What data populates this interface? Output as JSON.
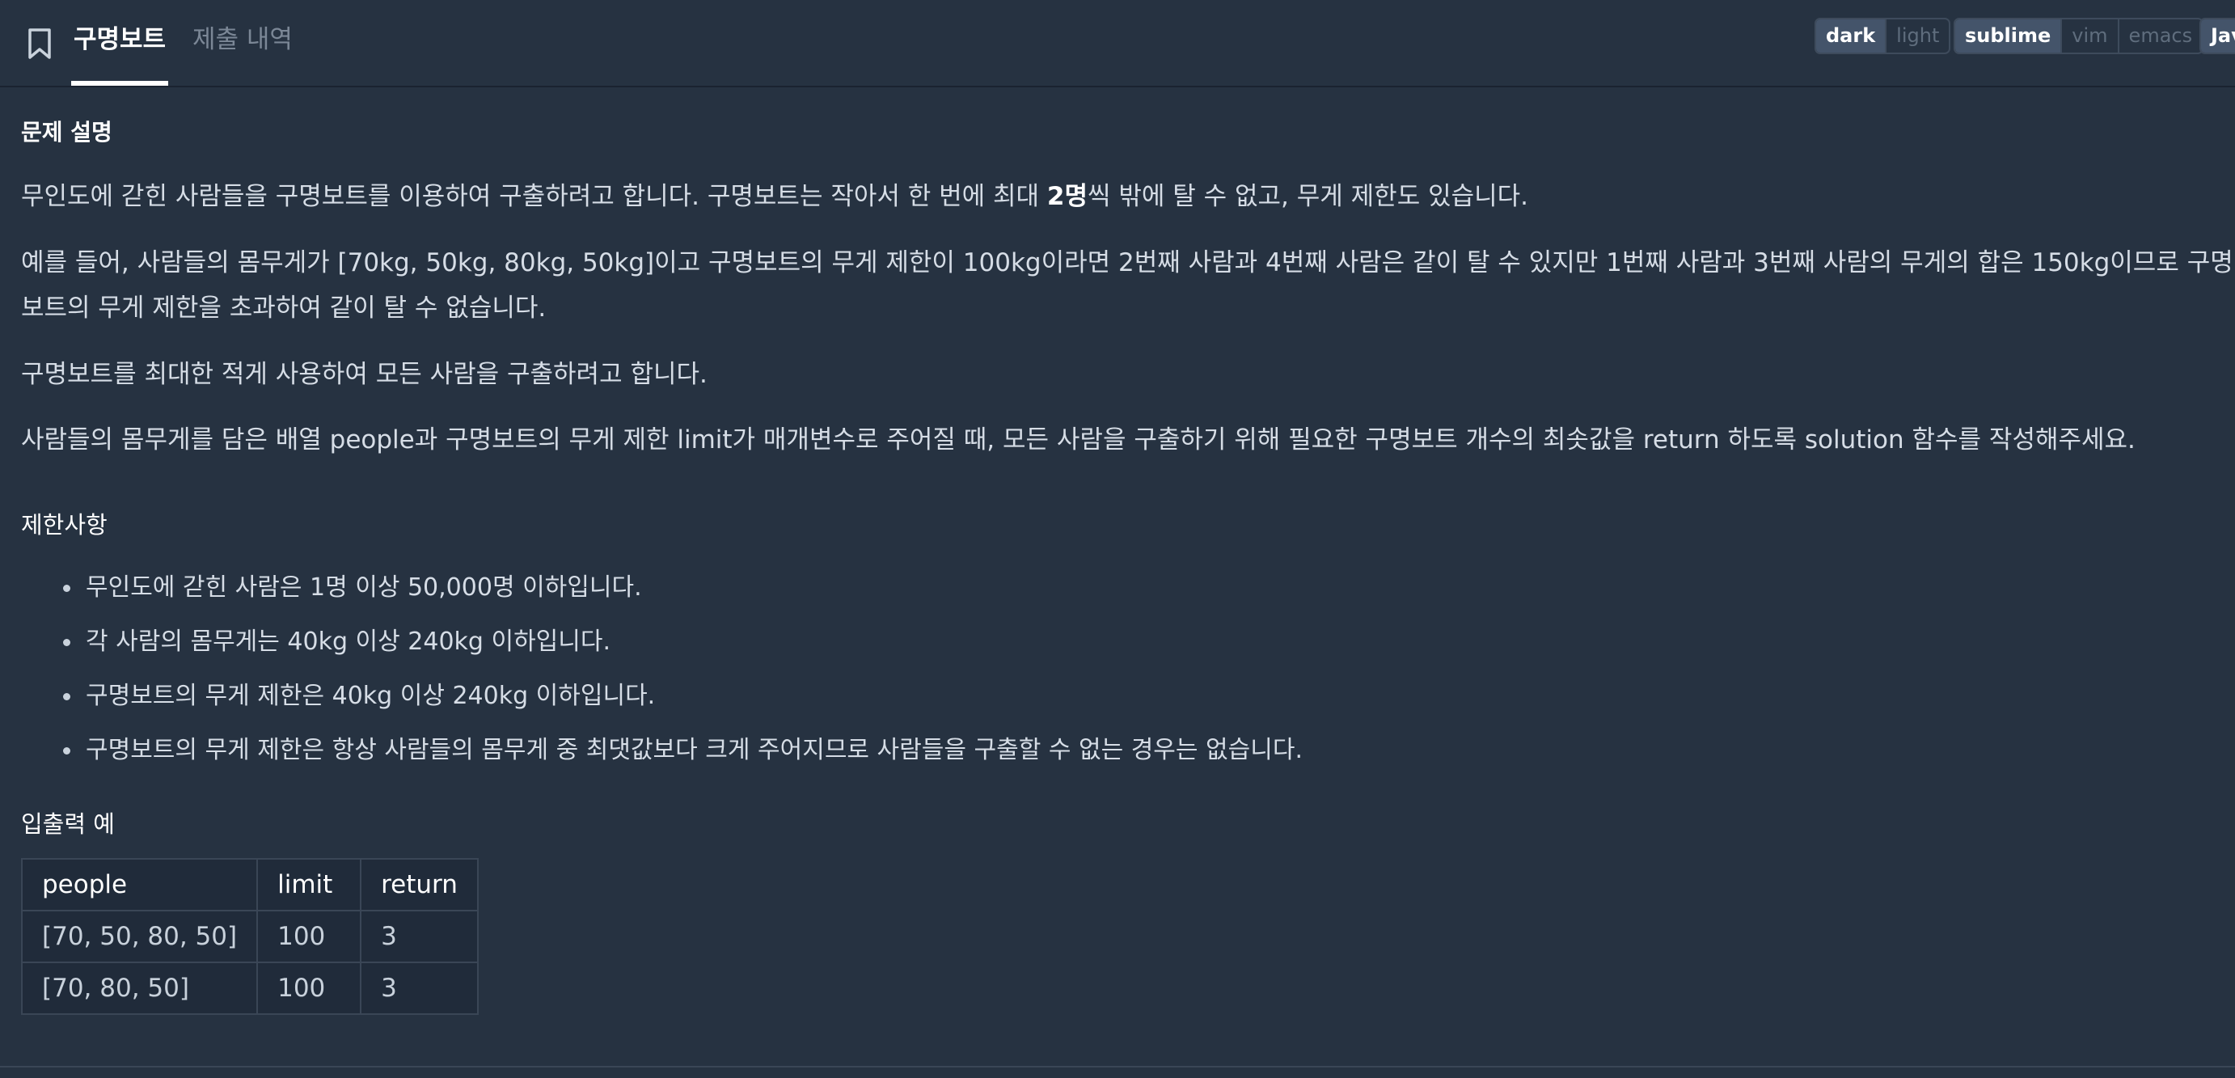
{
  "topbar": {
    "tabs": [
      {
        "label": "구명보트",
        "active": true
      },
      {
        "label": "제출 내역",
        "active": false
      }
    ],
    "theme_options": [
      {
        "label": "dark",
        "selected": true
      },
      {
        "label": "light",
        "selected": false
      }
    ],
    "keymap_options": [
      {
        "label": "sublime",
        "selected": true
      },
      {
        "label": "vim",
        "selected": false
      },
      {
        "label": "emacs",
        "selected": false
      }
    ],
    "language_label": "Jav",
    "icon": "bookmark-icon"
  },
  "problem": {
    "heading": "문제 설명",
    "paragraphs": [
      {
        "before": "무인도에 갇힌 사람들을 구명보트를 이용하여 구출하려고 합니다. 구명보트는 작아서 한 번에 최대 ",
        "bold": "2명",
        "after": "씩 밖에 탈 수 없고, 무게 제한도 있습니다."
      },
      {
        "line1": "예를 들어, 사람들의 몸무게가 [70kg, 50kg, 80kg, 50kg]이고 구명보트의 무게 제한이 100kg이라면 2번째 사람과 4번째 사람은 같이 탈 수 있지만 1번째 사람과 3번째 사람의 무게의 합은 150kg이므로 구명",
        "line2": "보트의 무게 제한을 초과하여 같이 탈 수 없습니다."
      },
      {
        "text": "구명보트를 최대한 적게 사용하여 모든 사람을 구출하려고 합니다."
      },
      {
        "text": "사람들의 몸무게를 담은 배열 people과 구명보트의 무게 제한 limit가 매개변수로 주어질 때, 모든 사람을 구출하기 위해 필요한 구명보트 개수의 최솟값을 return 하도록 solution 함수를 작성해주세요."
      }
    ]
  },
  "constraints": {
    "heading": "제한사항",
    "items": [
      "무인도에 갇힌 사람은 1명 이상 50,000명 이하입니다.",
      "각 사람의 몸무게는 40kg 이상 240kg 이하입니다.",
      "구명보트의 무게 제한은 40kg 이상 240kg 이하입니다.",
      "구명보트의 무게 제한은 항상 사람들의 몸무게 중 최댓값보다 크게 주어지므로 사람들을 구출할 수 없는 경우는 없습니다."
    ]
  },
  "examples": {
    "heading": "입출력 예",
    "headers": [
      "people",
      "limit",
      "return"
    ],
    "rows": [
      [
        "[70, 50, 80, 50]",
        "100",
        "3"
      ],
      [
        "[70, 80, 50]",
        "100",
        "3"
      ]
    ]
  }
}
